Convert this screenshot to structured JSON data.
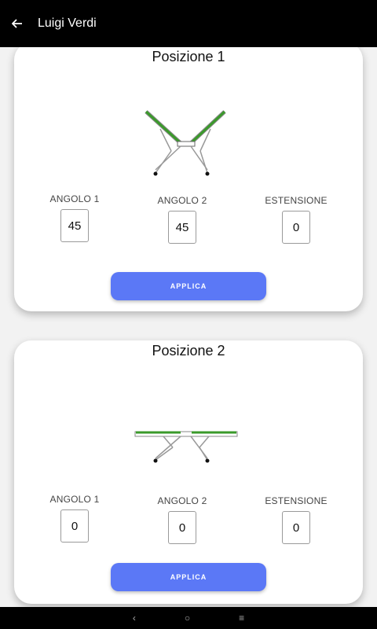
{
  "appbar": {
    "title": "Luigi Verdi",
    "back_icon": "arrow-left-icon"
  },
  "positions": [
    {
      "title": "Posizione 1",
      "params": [
        {
          "label": "ANGOLO 1",
          "value": "45"
        },
        {
          "label": "ANGOLO 2",
          "value": "45"
        },
        {
          "label": "ESTENSIONE",
          "value": "0"
        }
      ],
      "apply_label": "APPLICA"
    },
    {
      "title": "Posizione 2",
      "params": [
        {
          "label": "ANGOLO 1",
          "value": "0"
        },
        {
          "label": "ANGOLO 2",
          "value": "0"
        },
        {
          "label": "ESTENSIONE",
          "value": "0"
        }
      ],
      "apply_label": "APPLICA"
    }
  ],
  "navbar": {
    "back": "‹",
    "home": "○",
    "menu": "≡"
  },
  "colors": {
    "accent": "#5b78f6",
    "bed_green": "#3a9a2a"
  }
}
